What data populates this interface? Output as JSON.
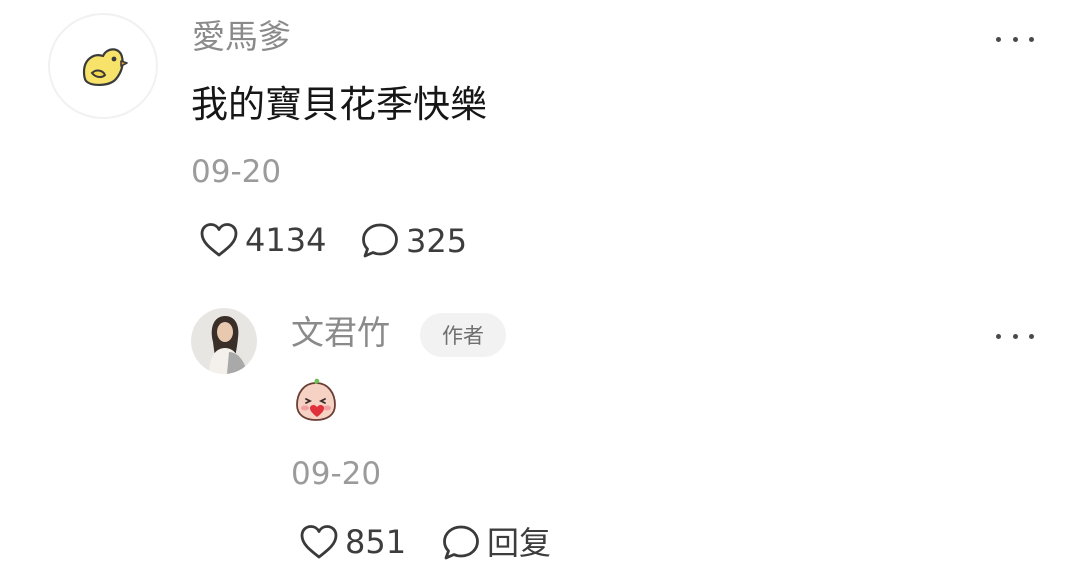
{
  "comment": {
    "username": "愛馬爹",
    "text": "我的寶貝花季快樂",
    "date": "09-20",
    "likes": "4134",
    "replies": "325",
    "avatar_icon": "yellow-chick-icon",
    "more_icon": "more-dots-icon"
  },
  "reply": {
    "username": "文君竹",
    "badge": "作者",
    "sticker_icon": "blushing-face-sticker",
    "date": "09-20",
    "likes": "851",
    "reply_label": "回复",
    "more_icon": "more-dots-icon"
  },
  "colors": {
    "username": "#8a8a8a",
    "date": "#9b9b9b",
    "badge_bg": "#f2f2f2",
    "chick": "#f7e36a"
  }
}
